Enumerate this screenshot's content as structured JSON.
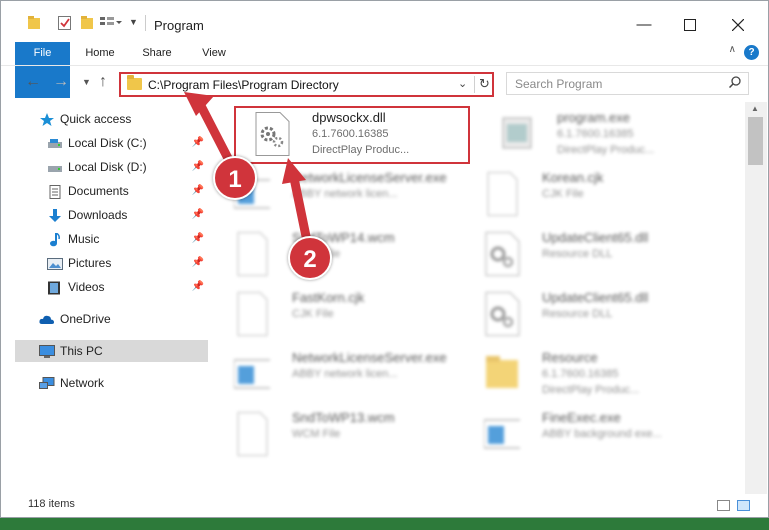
{
  "window": {
    "title": "Program"
  },
  "ribbon": {
    "tabs": [
      "File",
      "Home",
      "Share",
      "View"
    ],
    "help_label": "?"
  },
  "address": {
    "path": "C:\\Program Files\\Program Directory",
    "search_placeholder": "Search Program"
  },
  "sidebar": {
    "items": [
      {
        "label": "Quick access",
        "icon": "star-icon"
      },
      {
        "label": "Local Disk (C:)",
        "icon": "drive-icon",
        "pinned": true
      },
      {
        "label": "Local Disk (D:)",
        "icon": "drive-icon",
        "pinned": true
      },
      {
        "label": "Documents",
        "icon": "documents-icon",
        "pinned": true
      },
      {
        "label": "Downloads",
        "icon": "download-icon",
        "pinned": true
      },
      {
        "label": "Music",
        "icon": "music-icon",
        "pinned": true
      },
      {
        "label": "Pictures",
        "icon": "pictures-icon",
        "pinned": true
      },
      {
        "label": "Videos",
        "icon": "videos-icon",
        "pinned": true
      },
      {
        "label": "OneDrive",
        "icon": "cloud-icon"
      },
      {
        "label": "This PC",
        "icon": "pc-icon",
        "selected": true
      },
      {
        "label": "Network",
        "icon": "network-icon"
      }
    ]
  },
  "files": [
    {
      "name": "dpwsockx.dll",
      "line2": "6.1.7600.16385",
      "line3": "DirectPlay     Produc...",
      "icon": "dll-gear-icon"
    },
    {
      "name": "program.exe",
      "line2": "6.1.7600.16385",
      "line3": "DirectPlay     Produc...",
      "icon": "exe-icon"
    },
    {
      "name": "NetworkLicenseServer.exe",
      "line2": "ABBY network licen...",
      "line3": "",
      "icon": "exe-window-icon"
    },
    {
      "name": "Korean.cjk",
      "line2": "CJK File",
      "line3": "",
      "icon": "file-icon"
    },
    {
      "name": "SndToWP14.wcm",
      "line2": "WCM File",
      "line3": "",
      "icon": "file-icon"
    },
    {
      "name": "UpdateClient65.dll",
      "line2": "Resource DLL",
      "line3": "",
      "icon": "dll-gear-icon"
    },
    {
      "name": "FastKorn.cjk",
      "line2": "CJK File",
      "line3": "",
      "icon": "file-icon"
    },
    {
      "name": "UpdateClient65.dll",
      "line2": "Resource DLL",
      "line3": "",
      "icon": "dll-gear-icon"
    },
    {
      "name": "NetworkLicenseServer.exe",
      "line2": "ABBY network licen...",
      "line3": "",
      "icon": "exe-window-icon"
    },
    {
      "name": "Resource",
      "line2": "6.1.7600.16385",
      "line3": "DirectPlay     Produc...",
      "icon": "folder-icon"
    },
    {
      "name": "SndToWP13.wcm",
      "line2": "WCM File",
      "line3": "",
      "icon": "file-icon"
    },
    {
      "name": "FineExec.exe",
      "line2": "ABBY background exe...",
      "line3": "",
      "icon": "exe-window-icon"
    }
  ],
  "status": {
    "count": "118 items"
  },
  "annotations": {
    "step1": "1",
    "step2": "2",
    "color": "#d0343b"
  }
}
